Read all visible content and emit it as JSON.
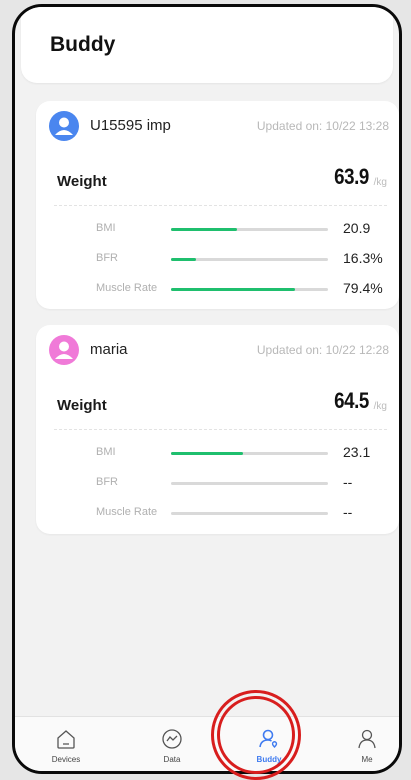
{
  "header": {
    "title": "Buddy",
    "menu_dots": "···"
  },
  "cards": [
    {
      "name": "U15595 imp",
      "updated": "Updated on: 10/22 13:28",
      "avatar_color": "#4a86ef",
      "weight_label": "Weight",
      "weight_value": "63.9",
      "weight_unit": "/kg",
      "metrics": [
        {
          "label": "BMI",
          "value": "20.9",
          "fill_fraction": 0.42
        },
        {
          "label": "BFR",
          "value": "16.3%",
          "fill_fraction": 0.16
        },
        {
          "label": "Muscle Rate",
          "value": "79.4%",
          "fill_fraction": 0.79
        }
      ]
    },
    {
      "name": "maria",
      "updated": "Updated on: 10/22 12:28",
      "avatar_color": "#f07ad8",
      "weight_label": "Weight",
      "weight_value": "64.5",
      "weight_unit": "/kg",
      "metrics": [
        {
          "label": "BMI",
          "value": "23.1",
          "fill_fraction": 0.46
        },
        {
          "label": "BFR",
          "value": "--",
          "fill_fraction": 0
        },
        {
          "label": "Muscle Rate",
          "value": "--",
          "fill_fraction": 0
        }
      ]
    }
  ],
  "nav": {
    "items": [
      {
        "label": "Devices",
        "icon": "home-icon"
      },
      {
        "label": "Data",
        "icon": "trend-icon"
      },
      {
        "label": "Buddy",
        "icon": "buddy-icon",
        "active": true
      },
      {
        "label": "Me",
        "icon": "person-icon"
      }
    ]
  },
  "colors": {
    "accent": "#3f7bf0",
    "bar_fill": "#1fbf6e",
    "bar_track": "#d9d9d9",
    "highlight_ring": "#d81e1e"
  }
}
